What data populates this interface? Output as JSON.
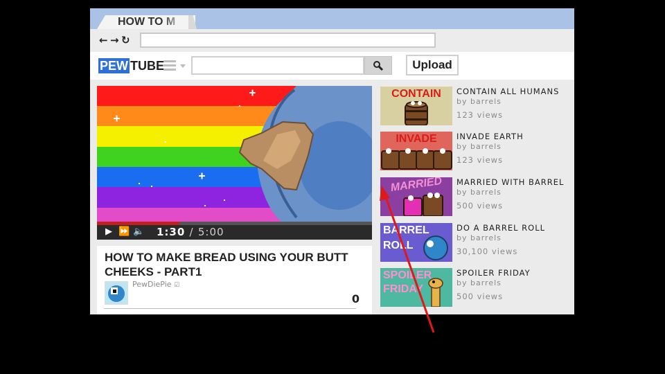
{
  "browser": {
    "tab_title": "HOW TO M",
    "nav": {
      "back": "←",
      "forward": "→",
      "reload": "↻"
    },
    "address_value": ""
  },
  "site": {
    "logo_part1": "PEW",
    "logo_part2": "TUBE",
    "search_placeholder": "",
    "upload_label": "Upload"
  },
  "player": {
    "current_time": "1:30",
    "separator": "/",
    "duration": "5:00",
    "progress_percent": 30,
    "icons": [
      "play-icon",
      "fast-forward-icon",
      "volume-icon"
    ]
  },
  "video": {
    "title": "HOW TO MAKE BREAD USING YOUR BUTT CHEEKS - PART1",
    "channel": "PewDiePie",
    "views": "0"
  },
  "sidebar": {
    "items": [
      {
        "thumb_label": "CONTAIN",
        "title": "CONTAIN ALL HUMANS",
        "by": "by barrels",
        "views": "123 views",
        "thumb_color": "#d8d0a0",
        "label_color": "#d81b1b"
      },
      {
        "thumb_label": "INVADE",
        "title": "INVADE EARTH",
        "by": "by barrels",
        "views": "123 views",
        "thumb_color": "#e0665c",
        "label_color": "#d81b1b"
      },
      {
        "thumb_label": "MARRIED",
        "title": "MARRIED WITH BARREL",
        "by": "by barrels",
        "views": "500 views",
        "thumb_color": "#8b3fa0",
        "label_color": "#f58fd3"
      },
      {
        "thumb_label_1": "BARREL",
        "thumb_label_2": "ROLL",
        "title": "DO A BARREL ROLL",
        "by": "by barrels",
        "views": "30,100 views",
        "thumb_color": "#6a5bd0",
        "label_color": "#ffffff"
      },
      {
        "thumb_label_1": "SPOILER",
        "thumb_label_2": "FRIDAY",
        "title": "SPOILER FRIDAY",
        "by": "by barrels",
        "views": "500 views",
        "thumb_color": "#4fb8a0",
        "label_color": "#ff8fd0"
      }
    ]
  },
  "colors": {
    "tabstrip": "#a9c2e6",
    "logo_blue": "#2e6fd8",
    "arrow_red": "#e01818"
  }
}
